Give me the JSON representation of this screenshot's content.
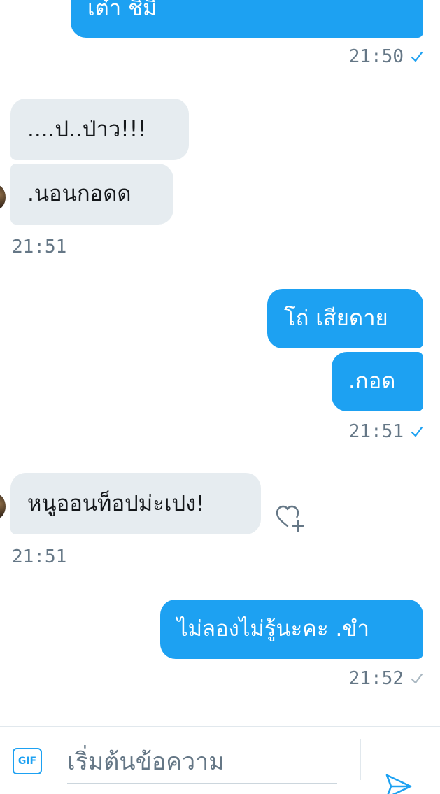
{
  "messages": [
    {
      "direction": "outgoing",
      "text": "เต๋า ชิมิ",
      "partial": true
    },
    {
      "direction": "outgoing",
      "timestamp": "21:50",
      "read": true
    },
    {
      "direction": "incoming",
      "text": "....ป..ป่าว!!!"
    },
    {
      "direction": "incoming",
      "text": ".นอนกอดด"
    },
    {
      "direction": "incoming",
      "timestamp": "21:51"
    },
    {
      "direction": "outgoing",
      "text": "โถ่ เสียดาย"
    },
    {
      "direction": "outgoing",
      "text": ".กอด"
    },
    {
      "direction": "outgoing",
      "timestamp": "21:51",
      "read": true
    },
    {
      "direction": "incoming",
      "text": "หนูออนท็อปม่ะเปง!"
    },
    {
      "direction": "incoming",
      "timestamp": "21:51"
    },
    {
      "direction": "outgoing",
      "text": "ไม่ลองไม่รู้นะคะ .ขำ"
    },
    {
      "direction": "outgoing",
      "timestamp": "21:52",
      "read": false
    }
  ],
  "composer": {
    "gif_label": "GIF",
    "placeholder": "เริ่มต้นข้อความ",
    "send_icon": "paper-plane-icon"
  },
  "icons": {
    "like": "heart-plus-icon",
    "read_receipt": "checkmark-icon"
  },
  "colors": {
    "outgoing_bubble": "#1da1f2",
    "incoming_bubble": "#e6ecf0",
    "read_check": "#1da1f2",
    "unread_check": "#aab8c2",
    "timestamp": "#657786"
  }
}
